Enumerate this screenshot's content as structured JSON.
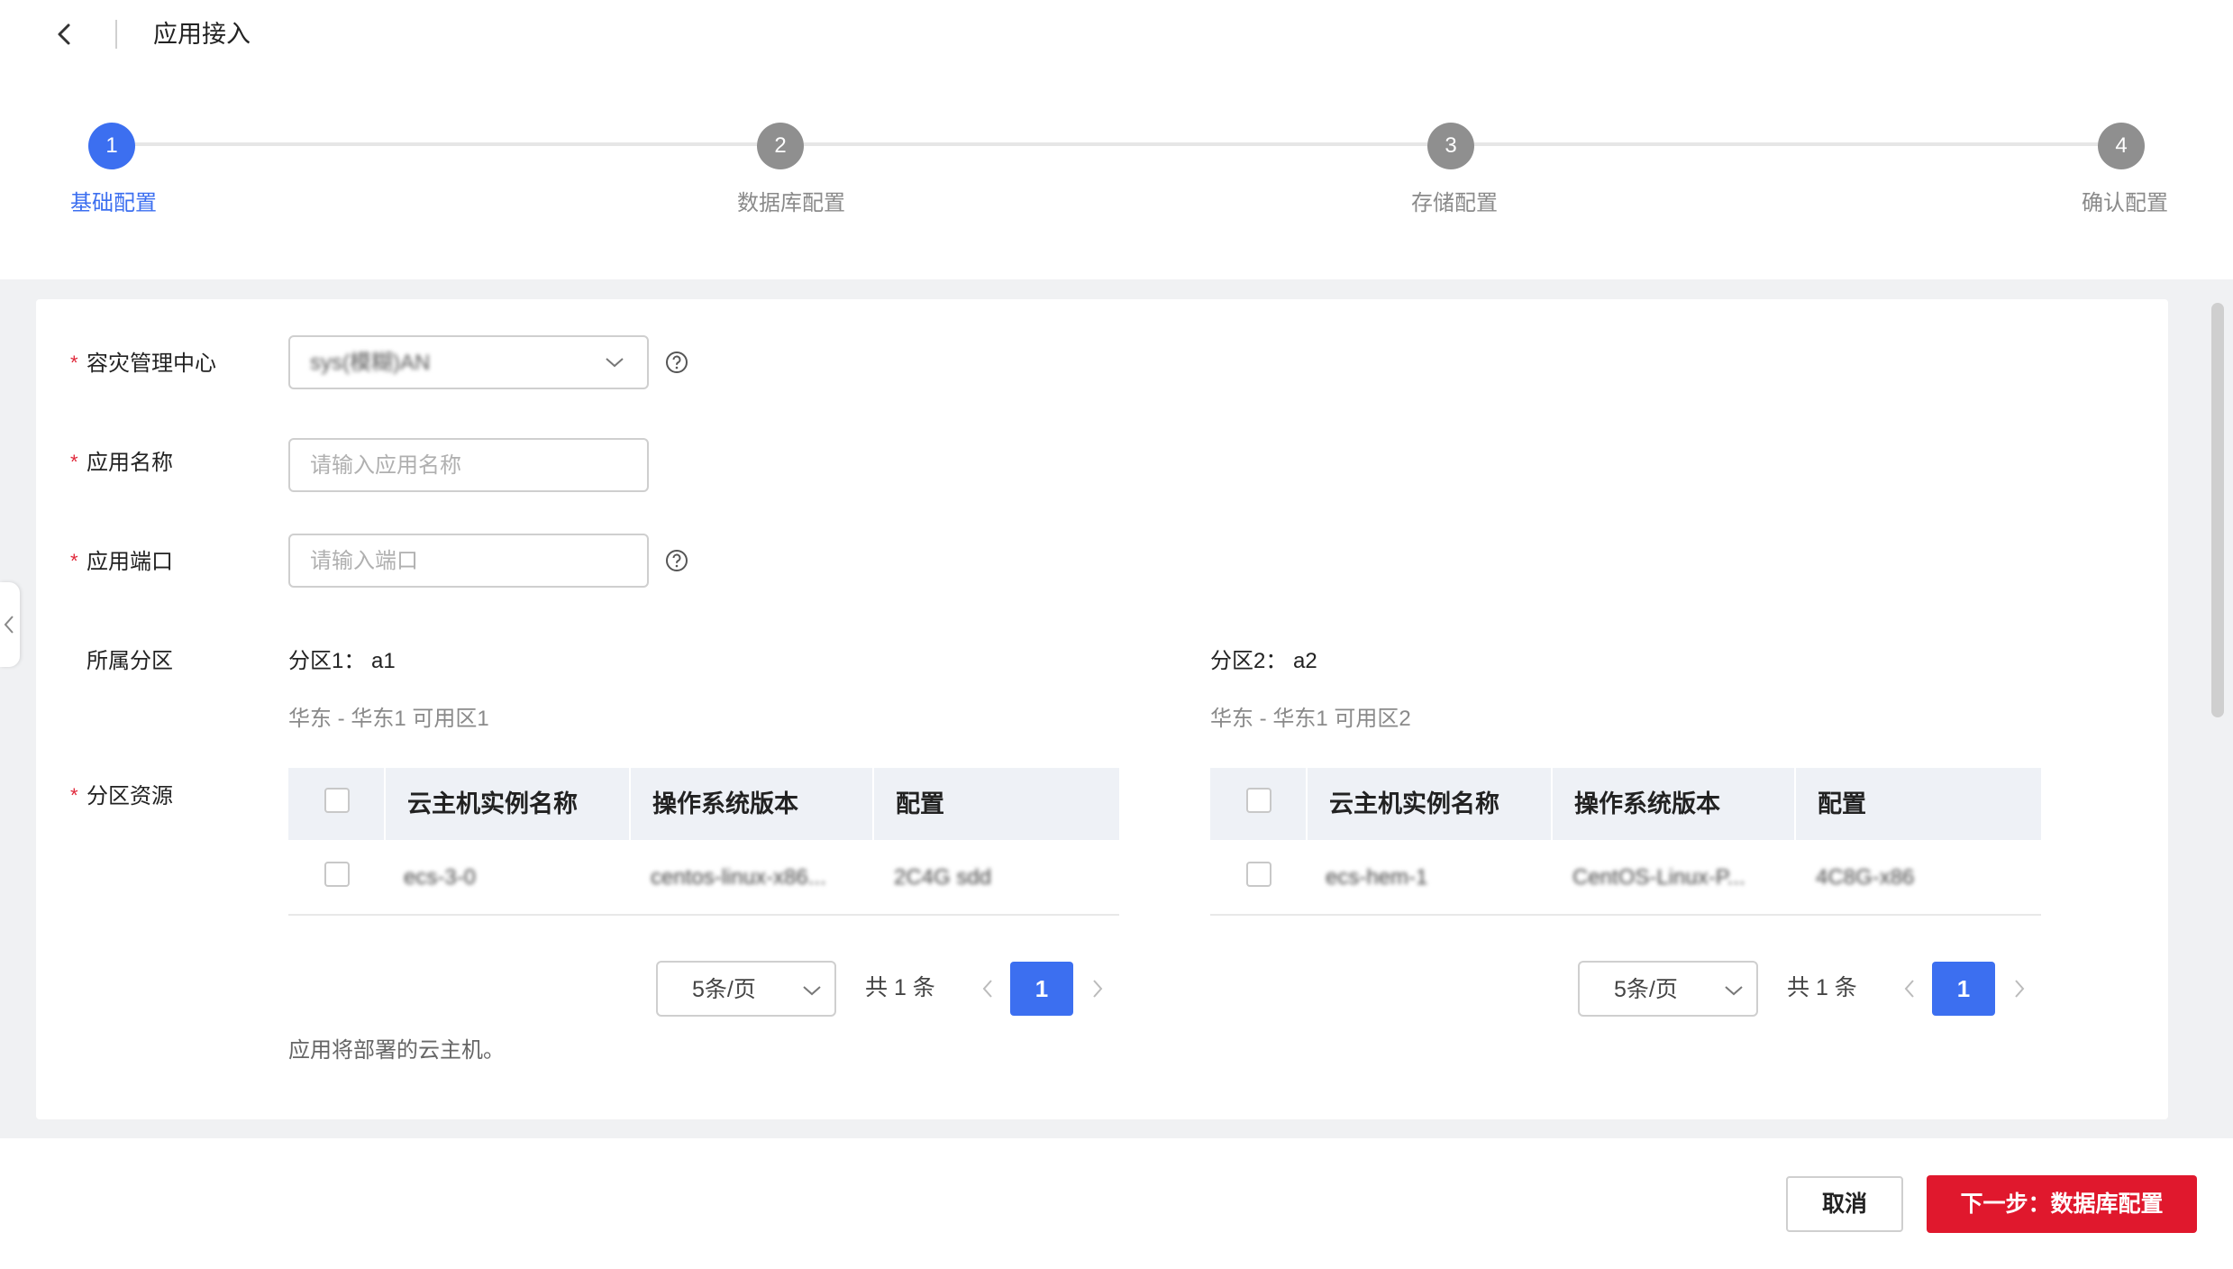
{
  "header": {
    "title": "应用接入"
  },
  "steps": [
    {
      "number": "1",
      "label": "基础配置",
      "active": true
    },
    {
      "number": "2",
      "label": "数据库配置",
      "active": false
    },
    {
      "number": "3",
      "label": "存储配置",
      "active": false
    },
    {
      "number": "4",
      "label": "确认配置",
      "active": false
    }
  ],
  "form": {
    "required_mark": "*",
    "dr_center": {
      "label": "容灾管理中心",
      "value": "sys(模糊)AN"
    },
    "app_name": {
      "label": "应用名称",
      "placeholder": "请输入应用名称"
    },
    "app_port": {
      "label": "应用端口",
      "placeholder": "请输入端口"
    },
    "zones": {
      "label": "所属分区",
      "zone1": {
        "title": "分区1：  a1",
        "region": "华东 - 华东1 可用区1"
      },
      "zone2": {
        "title": "分区2：  a2",
        "region": "华东 - 华东1 可用区2"
      }
    },
    "resources": {
      "label": "分区资源"
    },
    "hint": "应用将部署的云主机。"
  },
  "tables": {
    "columns": [
      "云主机实例名称",
      "操作系统版本",
      "配置"
    ],
    "left": {
      "row": [
        "ecs-3-0",
        "centos-linux-x86...",
        "2C4G sdd"
      ],
      "page_size": "5条/页",
      "total": "共 1 条",
      "current_page": "1"
    },
    "right": {
      "row": [
        "ecs-hem-1",
        "CentOS-Linux-P...",
        "4C8G-x86"
      ],
      "page_size": "5条/页",
      "total": "共 1 条",
      "current_page": "1"
    }
  },
  "footer": {
    "cancel_label": "取消",
    "next_label": "下一步：数据库配置"
  },
  "colors": {
    "accent": "#3c6ff0",
    "primary_button": "#e0182d",
    "required": "#e0283a"
  }
}
